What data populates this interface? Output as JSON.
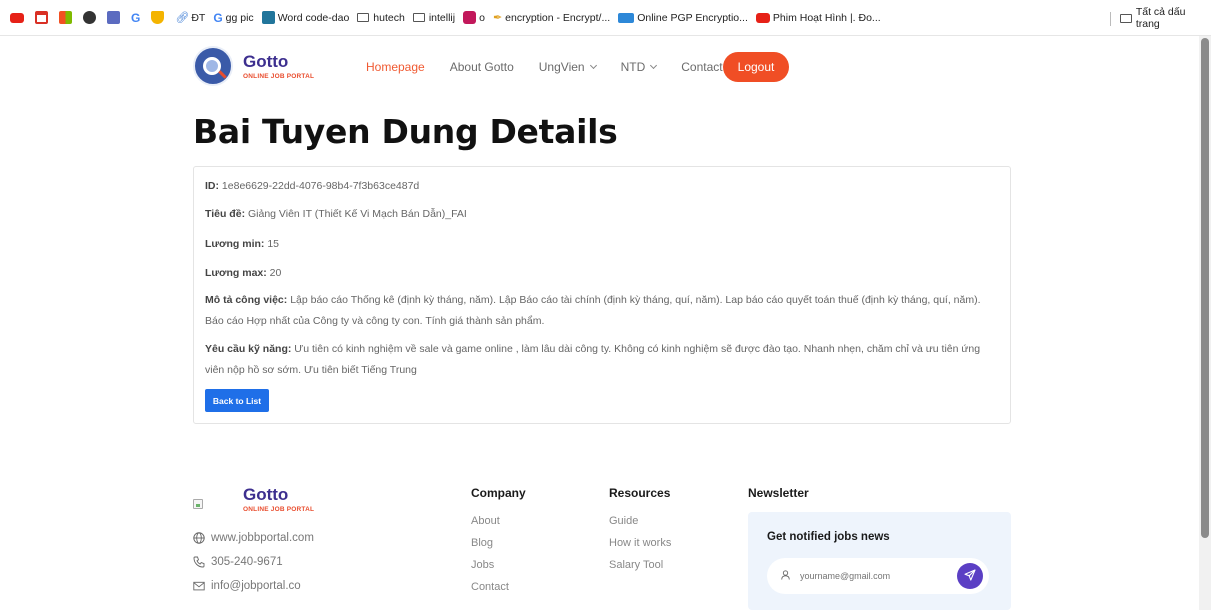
{
  "bookmarks": {
    "items": [
      {
        "label": "",
        "icon": "youtube-icon",
        "color": "#e62117"
      },
      {
        "label": "",
        "icon": "gmail-icon",
        "color": "#d93025"
      },
      {
        "label": "",
        "icon": "microsoft-icon",
        "color": "#f25022"
      },
      {
        "label": "",
        "icon": "chatgpt-icon",
        "color": "#333333"
      },
      {
        "label": "",
        "icon": "teams-icon",
        "color": "#5b6bc0"
      },
      {
        "label": "",
        "icon": "google-icon",
        "color": "#4285f4"
      },
      {
        "label": "",
        "icon": "shield-icon",
        "color": "#f4b400"
      },
      {
        "label": "ĐT",
        "icon": "link-icon",
        "color": "#3a7bd5"
      },
      {
        "label": "gg pic",
        "icon": "google-icon",
        "color": "#4285f4"
      },
      {
        "label": "Word code-dao",
        "icon": "wordpress-icon",
        "color": "#21759b"
      },
      {
        "label": "hutech",
        "icon": "folder-icon",
        "color": "#555555"
      },
      {
        "label": "intellij",
        "icon": "folder-icon",
        "color": "#555555"
      },
      {
        "label": "o",
        "icon": "app-icon",
        "color": "#c2185b"
      },
      {
        "label": "encryption - Encrypt/...",
        "icon": "key-icon",
        "color": "#e0a020"
      },
      {
        "label": "Online PGP Encryptio...",
        "icon": "lock-icon",
        "color": "#2d88d8"
      },
      {
        "label": "Phim Hoạt Hình |. Đo...",
        "icon": "youtube-icon",
        "color": "#e62117"
      }
    ],
    "all_bookmarks": "Tất cả dấu trang"
  },
  "nav": {
    "logo_title": "Gotto",
    "logo_subtitle": "ONLINE JOB PORTAL",
    "items": [
      {
        "label": "Homepage",
        "active": true
      },
      {
        "label": "About Gotto",
        "active": false
      },
      {
        "label": "UngVien",
        "active": false,
        "dropdown": true
      },
      {
        "label": "NTD",
        "active": false,
        "dropdown": true
      },
      {
        "label": "Contact",
        "active": false
      }
    ],
    "logout": "Logout"
  },
  "page": {
    "title": "Bai Tuyen Dung Details"
  },
  "details": {
    "id_label": "ID:",
    "id_value": "1e8e6629-22dd-4076-98b4-7f3b63ce487d",
    "title_label": "Tiêu đề:",
    "title_value": "Giảng Viên IT (Thiết Kế Vi Mạch Bán Dẫn)_FAI",
    "salary_min_label": "Lương min:",
    "salary_min_value": "15",
    "salary_max_label": "Lương max:",
    "salary_max_value": "20",
    "desc_label": "Mô tả công việc:",
    "desc_value": "Lập báo cáo Thống kê (định kỳ tháng, năm). Lập Báo cáo tài chính (định kỳ tháng, quí, năm). Lap báo cáo quyết toán thuế (định kỳ tháng, quí, năm). Báo cáo Hợp nhất của Công ty và công ty con. Tính giá thành sản phẩm.",
    "skills_label": "Yêu cầu kỹ năng:",
    "skills_value": "Ưu tiên có kinh nghiệm về sale và game online , làm lâu dài công ty. Không có kinh nghiệm sẽ được đào tạo. Nhanh nhẹn, chăm chỉ và ưu tiên ứng viên nộp hồ sơ sớm. Ưu tiên biết Tiếng Trung",
    "back_button": "Back to List"
  },
  "footer": {
    "logo_title": "Gotto",
    "logo_subtitle": "ONLINE JOB PORTAL",
    "website": "www.jobbportal.com",
    "phone": "305-240-9671",
    "email": "info@jobportal.co",
    "company": {
      "title": "Company",
      "links": [
        "About",
        "Blog",
        "Jobs",
        "Contact"
      ]
    },
    "resources": {
      "title": "Resources",
      "links": [
        "Guide",
        "How it works",
        "Salary Tool"
      ]
    },
    "newsletter": {
      "title": "Newsletter",
      "box_title": "Get notified jobs news",
      "placeholder": "yourname@gmail.com"
    }
  },
  "colors": {
    "accent": "#f04e25",
    "brand": "#3d2f8f",
    "primary_button": "#1f6fe8",
    "send_button": "#5b3fc4"
  }
}
